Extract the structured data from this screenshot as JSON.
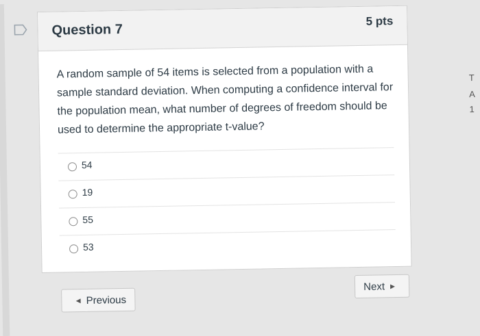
{
  "question": {
    "title": "Question 7",
    "points": "5 pts",
    "text": "A random sample of 54 items is selected from a population with a sample standard deviation. When computing a confidence interval for the population mean, what number of degrees of freedom should be used to determine the appropriate t-value?"
  },
  "answers": [
    "54",
    "19",
    "55",
    "53"
  ],
  "navigation": {
    "previous_label": "Previous",
    "next_label": "Next"
  },
  "edge_text": [
    "T",
    "A",
    "1"
  ]
}
